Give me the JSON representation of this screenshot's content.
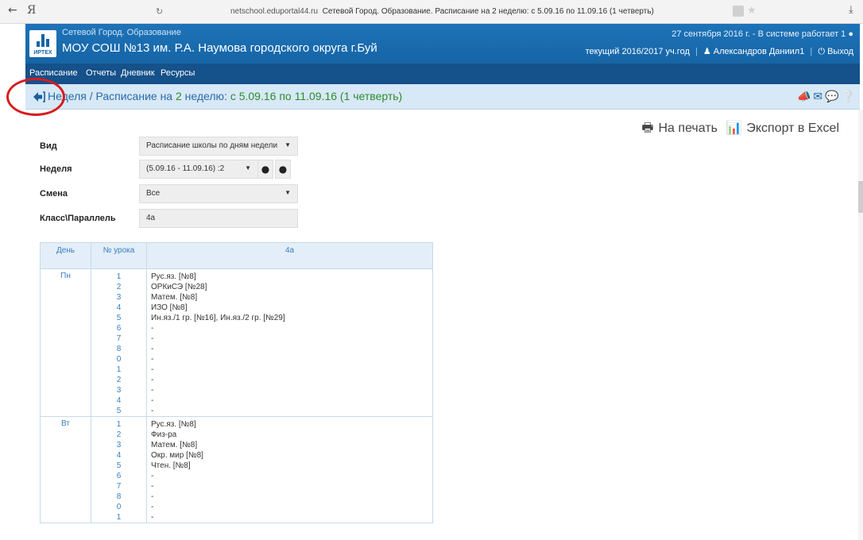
{
  "browser": {
    "back": "←",
    "logo": "Я",
    "reload": "↻",
    "url_host": "netschool.eduportal44.ru",
    "url_title": "Сетевой Город. Образование. Расписание на 2 неделю: с 5.09.16 по 11.09.16 (1 четверть)",
    "download": "⤓"
  },
  "header": {
    "logo_label": "ИРТЕХ",
    "subtitle": "Сетевой Город. Образование",
    "title": "МОУ СОШ №13 им. Р.А. Наумова городского округа г.Буй",
    "date_info": "27 сентября 2016 г. - В системе работает 1",
    "school_year": "текущий 2016/2017 уч.год",
    "user": "Александров Даниил1",
    "exit": "Выход"
  },
  "menu": {
    "items": [
      "Расписание",
      "Отчеты",
      "Дневник",
      "Ресурсы"
    ]
  },
  "crumb": {
    "prefix": "Неделя / Расписание на ",
    "week_num": "2",
    "mid": " неделю: ",
    "range": "с 5.09.16 по 11.09.16 (1 четверть)"
  },
  "actions": {
    "print": "На печать",
    "export": "Экспорт в Excel"
  },
  "form": {
    "view_label": "Вид",
    "view_value": "Расписание школы по дням недели",
    "week_label": "Неделя",
    "week_value": "(5.09.16 - 11.09.16) :2",
    "shift_label": "Смена",
    "shift_value": "Все",
    "class_label": "Класс\\Параллель",
    "class_value": "4а"
  },
  "table": {
    "headers": {
      "day": "День",
      "num": "№ урока",
      "class": "4а"
    },
    "days": [
      {
        "name": "Пн",
        "nums": [
          "1",
          "2",
          "3",
          "4",
          "5",
          "6",
          "7",
          "8",
          "0",
          "1",
          "2",
          "3",
          "4",
          "5"
        ],
        "lessons": [
          "Рус.яз. [№8]",
          "ОРКиСЭ [№28]",
          "Матем. [№8]",
          "ИЗО [№8]",
          "Ин.яз./1 гр. [№16], Ин.яз./2 гр. [№29]",
          "-",
          "-",
          "-",
          "-",
          "-",
          "-",
          "-",
          "-",
          "-"
        ]
      },
      {
        "name": "Вт",
        "nums": [
          "1",
          "2",
          "3",
          "4",
          "5",
          "6",
          "7",
          "8",
          "0",
          "1"
        ],
        "lessons": [
          "Рус.яз. [№8]",
          "Физ-ра",
          "Матем. [№8]",
          "Окр. мир [№8]",
          "Чтен. [№8]",
          "-",
          "-",
          "-",
          "-",
          "-"
        ]
      }
    ]
  }
}
